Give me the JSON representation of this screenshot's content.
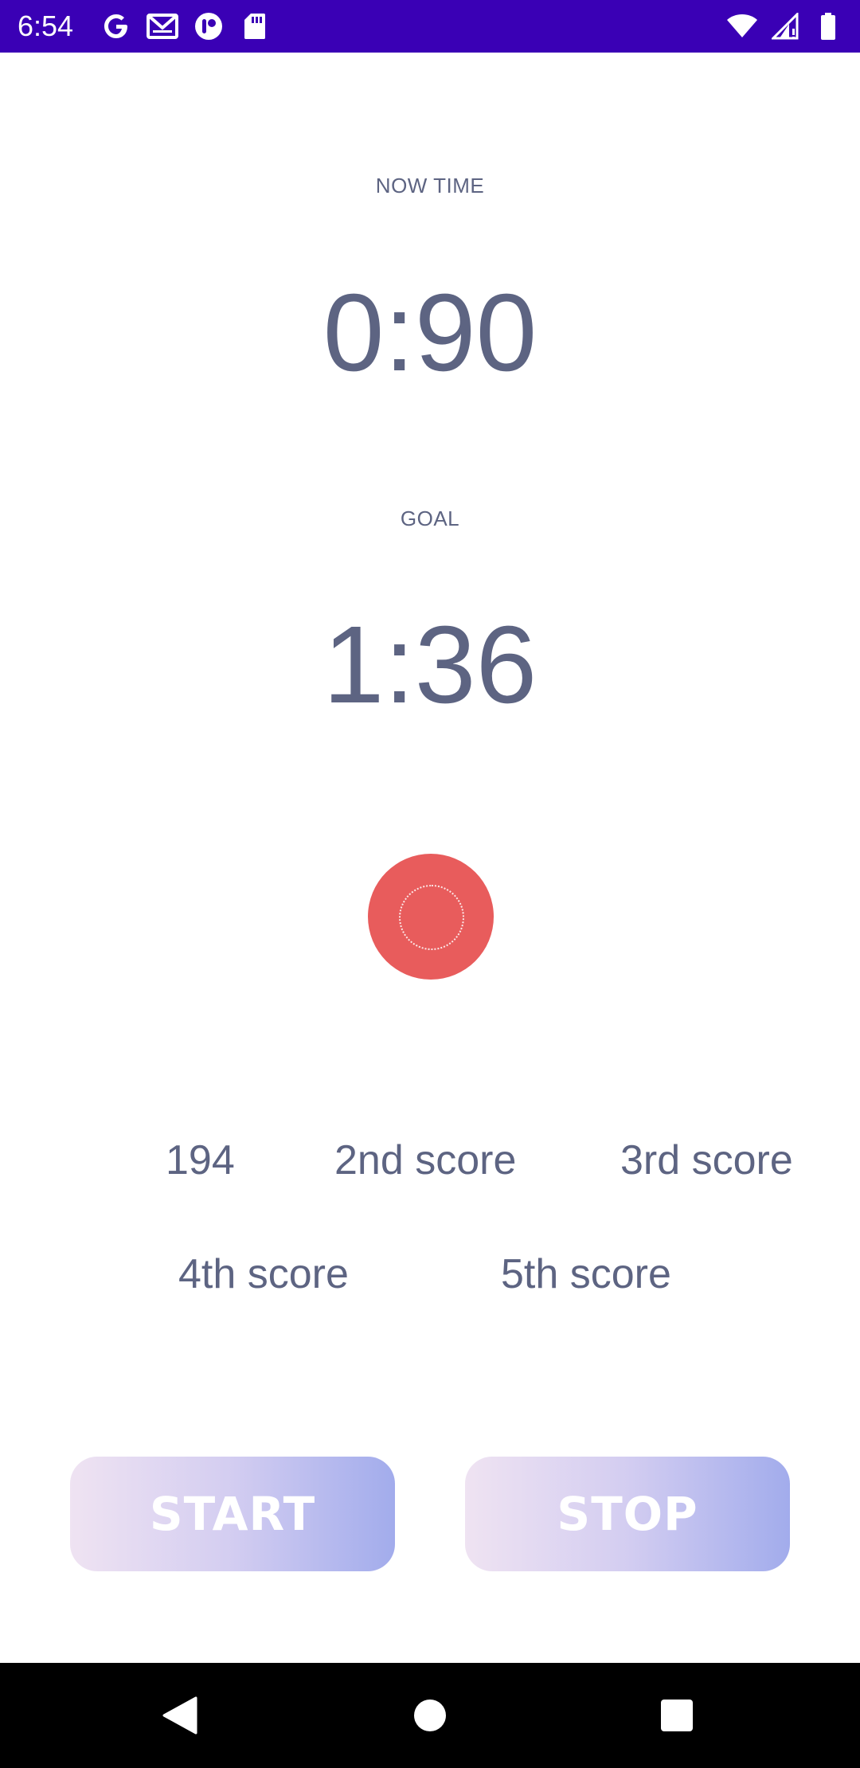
{
  "status_bar": {
    "time": "6:54",
    "background": "#3a00b5",
    "left_icons": [
      "google-icon",
      "gmail-icon",
      "podcast-app-icon",
      "sd-card-icon"
    ],
    "right_icons": [
      "wifi-icon",
      "cell-signal-icon",
      "battery-icon"
    ]
  },
  "main": {
    "now_time_label": "NOW TIME",
    "now_time_value": "0:90",
    "goal_label": "GOAL",
    "goal_value": "1:36",
    "record_button_color": "#e85c5c",
    "text_color": "#5d6482"
  },
  "scores": {
    "first": "194",
    "second": "2nd score",
    "third": "3rd score",
    "fourth": "4th score",
    "fifth": "5th score"
  },
  "buttons": {
    "start_label": "START",
    "stop_label": "STOP"
  },
  "nav_bar": {
    "icons": [
      "back-icon",
      "home-icon",
      "recents-icon"
    ]
  }
}
